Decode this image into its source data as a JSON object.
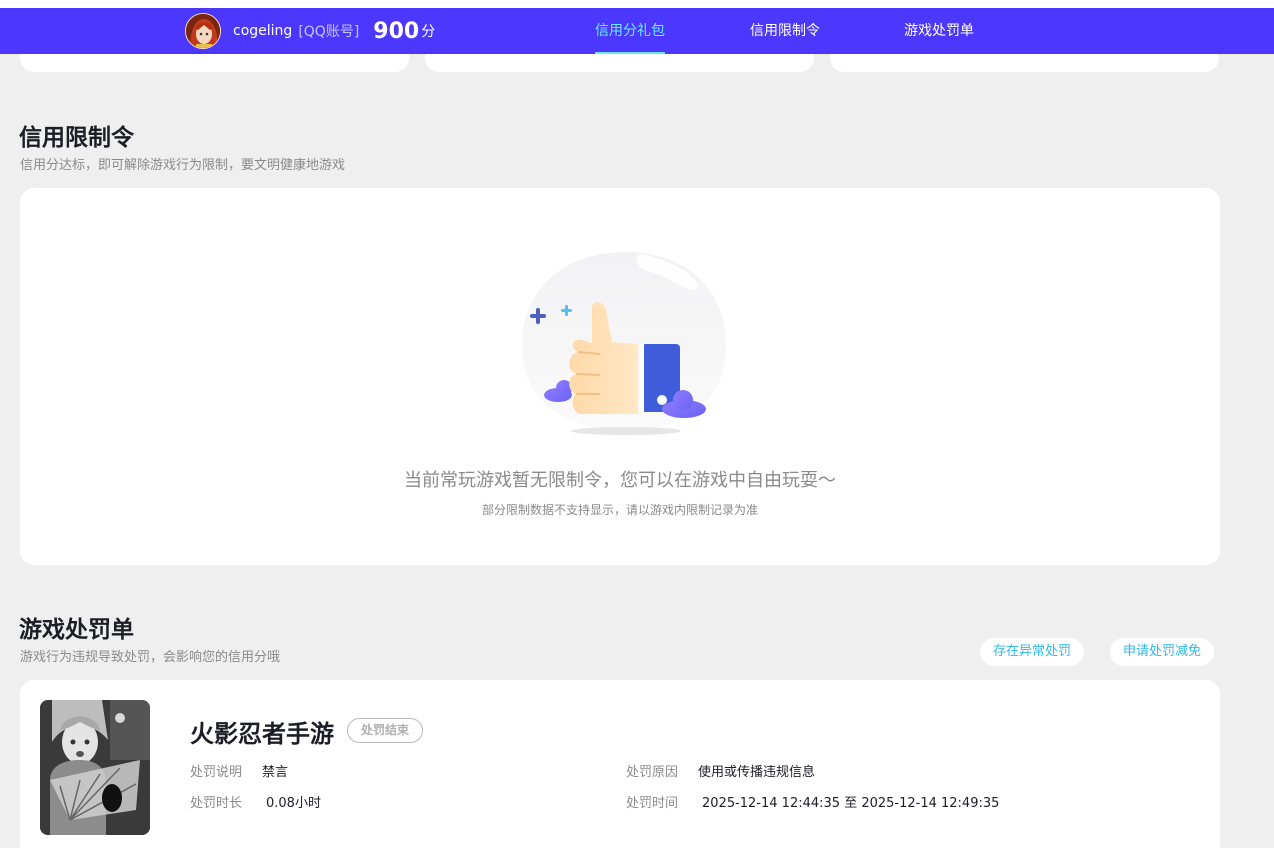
{
  "navbar": {
    "username": "cogeling",
    "account_type": "[QQ账号]",
    "score": "900",
    "score_unit": "分",
    "tabs": [
      {
        "label": "信用分礼包",
        "active": true
      },
      {
        "label": "信用限制令",
        "active": false
      },
      {
        "label": "游戏处罚单",
        "active": false
      }
    ],
    "colors": {
      "bar": "#4c37ff",
      "active_tab": "#6ce9ff"
    }
  },
  "restriction": {
    "title": "信用限制令",
    "subtitle": "信用分达标，即可解除游戏行为限制，要文明健康地游戏",
    "empty_message": "当前常玩游戏暂无限制令，您可以在游戏中自由玩耍～",
    "empty_note": "部分限制数据不支持显示，请以游戏内限制记录为准",
    "illustration_icon": "thumbs-up-icon"
  },
  "penalty": {
    "title": "游戏处罚单",
    "subtitle": "游戏行为违规导致处罚，会影响您的信用分哦",
    "actions": [
      "存在异常处罚",
      "申请处罚减免"
    ],
    "record": {
      "game": "火影忍者手游",
      "status": "处罚结束",
      "description_label": "处罚说明",
      "description_value": "禁言",
      "duration_label": "处罚时长",
      "duration_value": "0.08小时",
      "reason_label": "处罚原因",
      "reason_value": "使用或传播违规信息",
      "time_label": "处罚时间",
      "time_value": "2025-12-14 12:44:35 至 2025-12-14 12:49:35"
    }
  }
}
